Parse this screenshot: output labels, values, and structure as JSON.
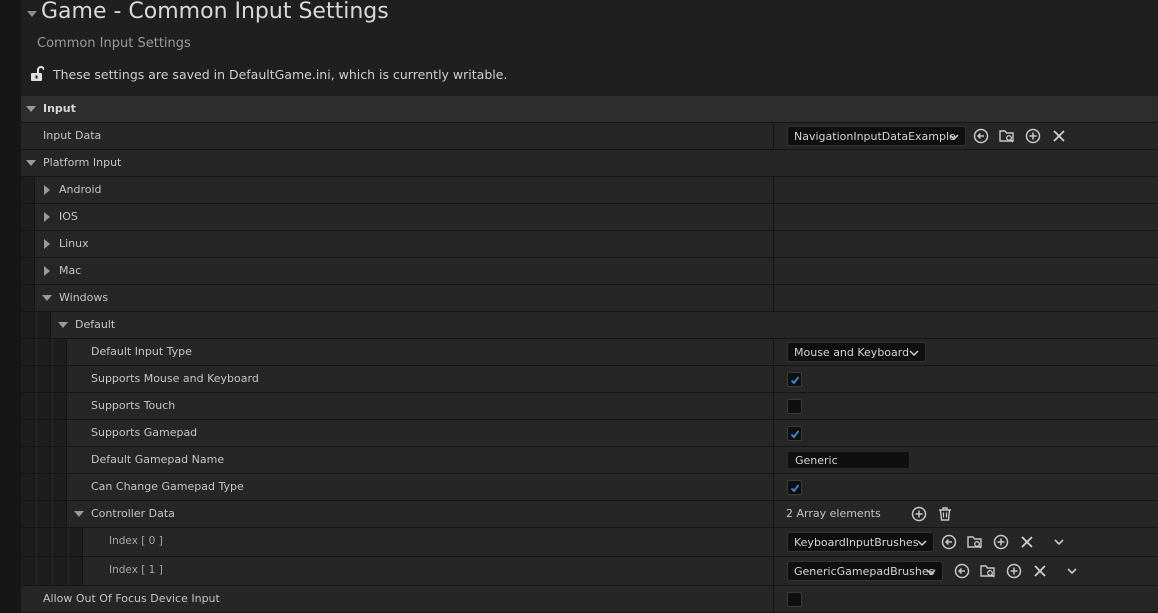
{
  "header": {
    "title": "Game - Common Input Settings",
    "subtitle": "Common Input Settings",
    "notice": "These settings are saved in DefaultGame.ini, which is currently writable."
  },
  "section": {
    "label": "Input"
  },
  "input_data": {
    "label": "Input Data",
    "value": "NavigationInputDataExample"
  },
  "platform_input": {
    "label": "Platform Input",
    "platforms": [
      "Android",
      "IOS",
      "Linux",
      "Mac",
      "Windows"
    ]
  },
  "default_group": {
    "label": "Default"
  },
  "default_input_type": {
    "label": "Default Input Type",
    "value": "Mouse and Keyboard"
  },
  "supports_mouse": {
    "label": "Supports Mouse and Keyboard",
    "checked": true
  },
  "supports_touch": {
    "label": "Supports Touch",
    "checked": false
  },
  "supports_gamepad": {
    "label": "Supports Gamepad",
    "checked": true
  },
  "default_gamepad_name": {
    "label": "Default Gamepad Name",
    "value": "Generic"
  },
  "can_change_gamepad": {
    "label": "Can Change Gamepad Type",
    "checked": true
  },
  "controller_data": {
    "label": "Controller Data",
    "count_text": "2 Array elements",
    "items": [
      {
        "label": "Index [ 0 ]",
        "value": "KeyboardInputBrushes"
      },
      {
        "label": "Index [ 1 ]",
        "value": "GenericGamepadBrushes"
      }
    ]
  },
  "allow_out_of_focus": {
    "label": "Allow Out Of Focus Device Input",
    "checked": false
  },
  "icons": [
    "collapse-arrow-icon",
    "unlock-icon",
    "use-selected-icon",
    "browse-icon",
    "add-icon",
    "clear-icon",
    "delete-icon",
    "chevron-down-icon",
    "checkmark-icon"
  ],
  "colors": {
    "checkmark": "#3a8fe6",
    "background": "#1a1a1a",
    "row": "#262626"
  }
}
